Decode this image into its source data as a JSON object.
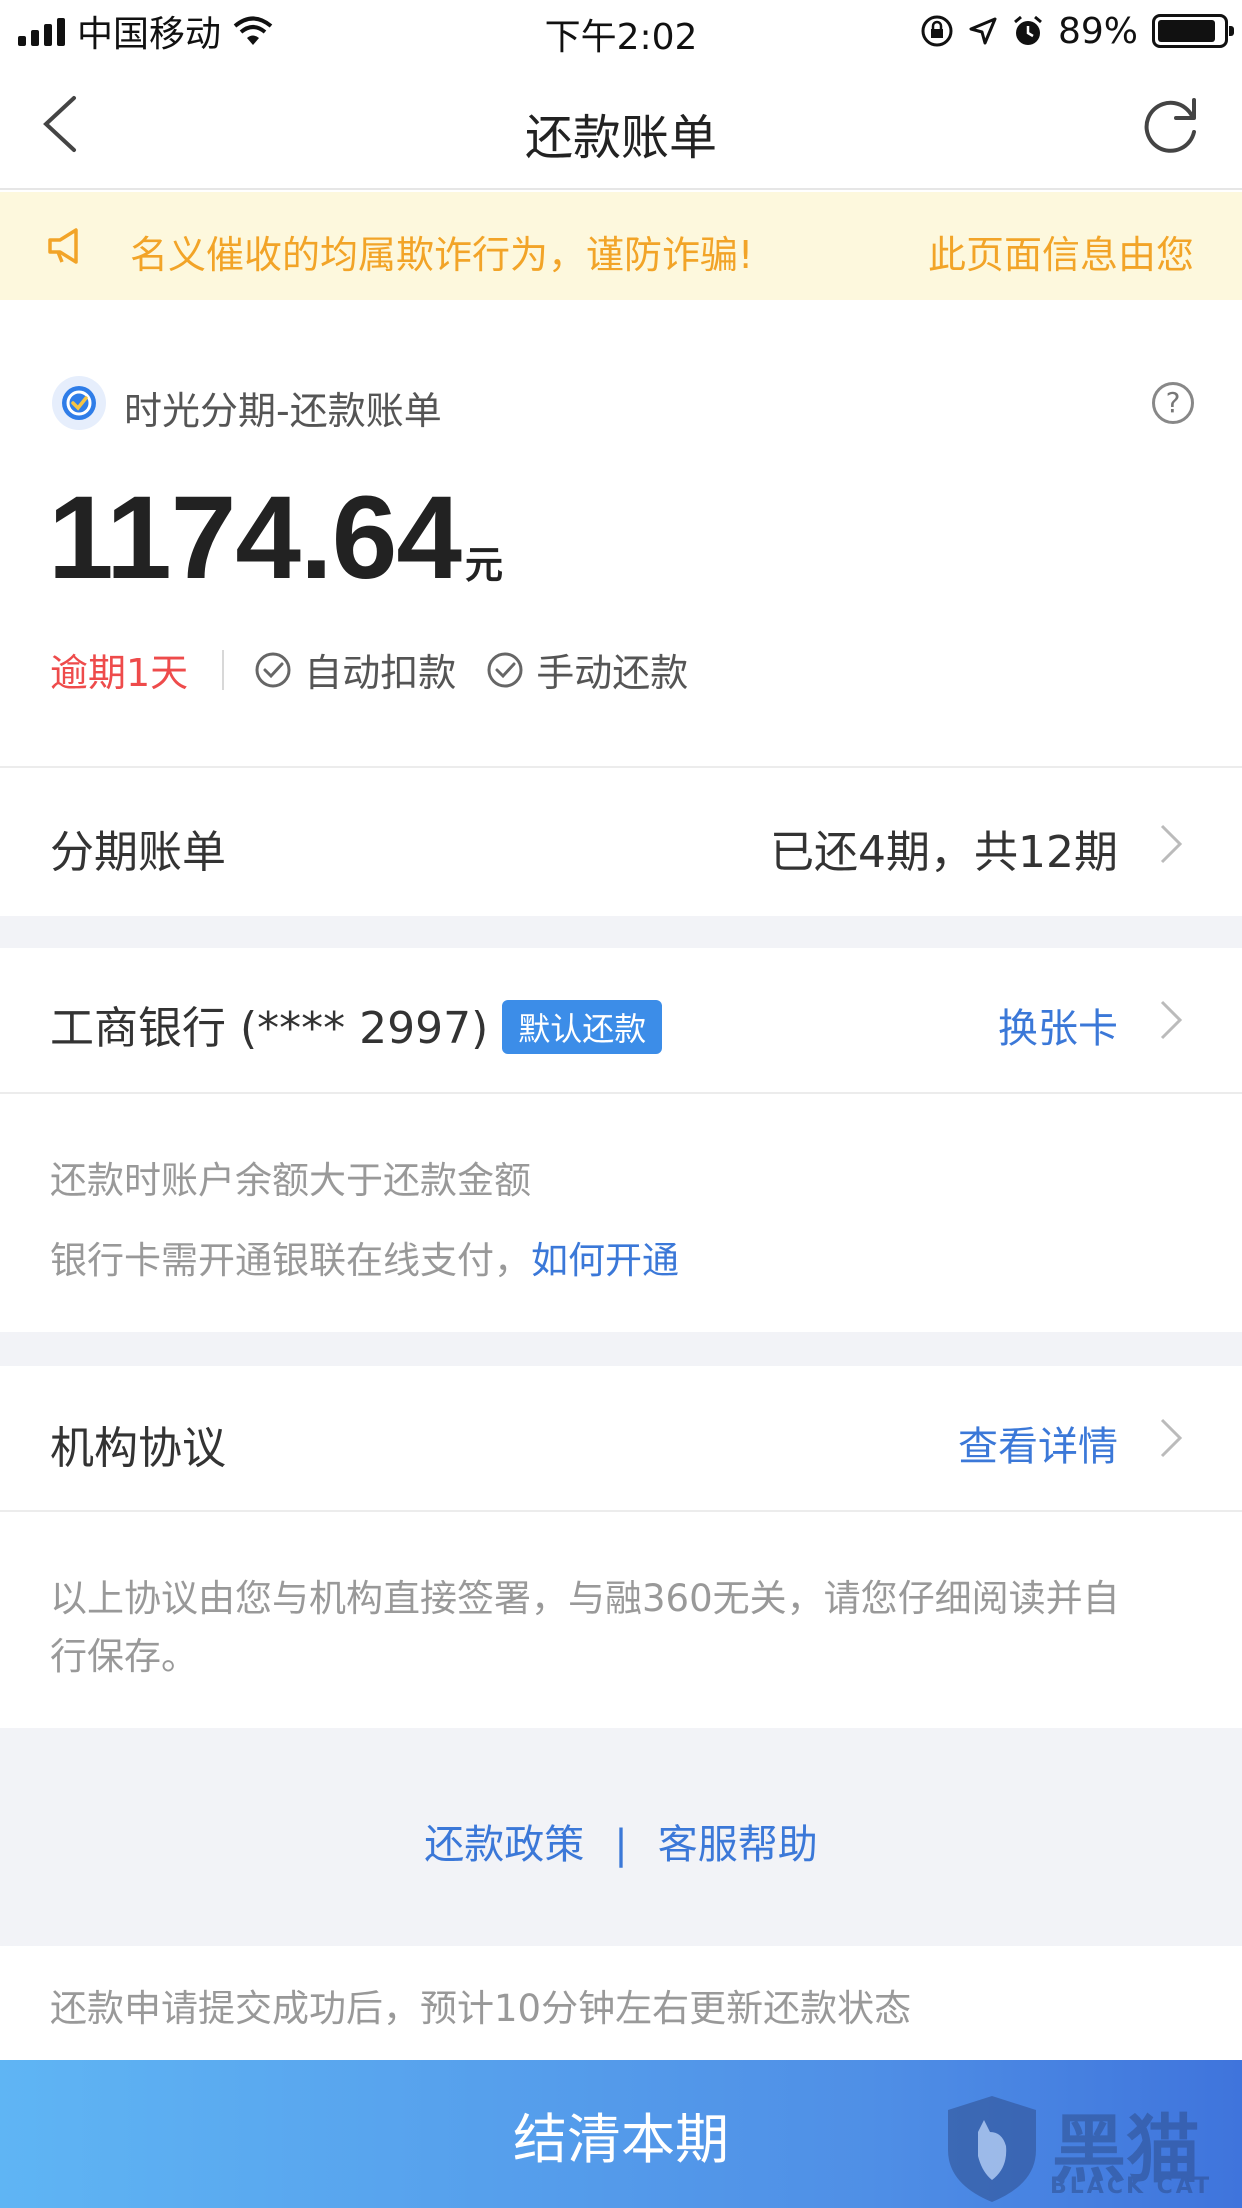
{
  "status_bar": {
    "carrier": "中国移动",
    "time": "下午2:02",
    "battery": "89%",
    "battery_level": 0.89
  },
  "nav": {
    "title": "还款账单"
  },
  "notice": {
    "text": "名义催收的均属欺诈行为，谨防诈骗!",
    "text2": "此页面信息由您"
  },
  "summary": {
    "brand": "时光分期-还款账单",
    "amount": "1174.64",
    "unit": "元",
    "overdue": "逾期1天",
    "auto_pay": "自动扣款",
    "manual_pay": "手动还款"
  },
  "installment": {
    "label": "分期账单",
    "value": "已还4期，共12期"
  },
  "bank": {
    "name": "工商银行 (**** 2997)",
    "badge": "默认还款",
    "change": "换张卡",
    "note1": "还款时账户余额大于还款金额",
    "note2": "银行卡需开通银联在线支付，",
    "note2_link": "如何开通"
  },
  "agreement": {
    "label": "机构协议",
    "link": "查看详情",
    "note_line1": "以上协议由您与机构直接签署，与融360无关，请您仔细阅读并自",
    "note_line2": "行保存。"
  },
  "footer": {
    "policy": "还款政策",
    "separator": "|",
    "support": "客服帮助"
  },
  "tip": "还款申请提交成功后，预计10分钟左右更新还款状态",
  "pay_button": "结清本期",
  "watermark": {
    "text": "黑猫",
    "sub": "BLACK CAT"
  },
  "colors": {
    "accent_blue": "#3b78d8",
    "overdue_red": "#ee4b4b",
    "notice_orange": "#f2a428"
  }
}
